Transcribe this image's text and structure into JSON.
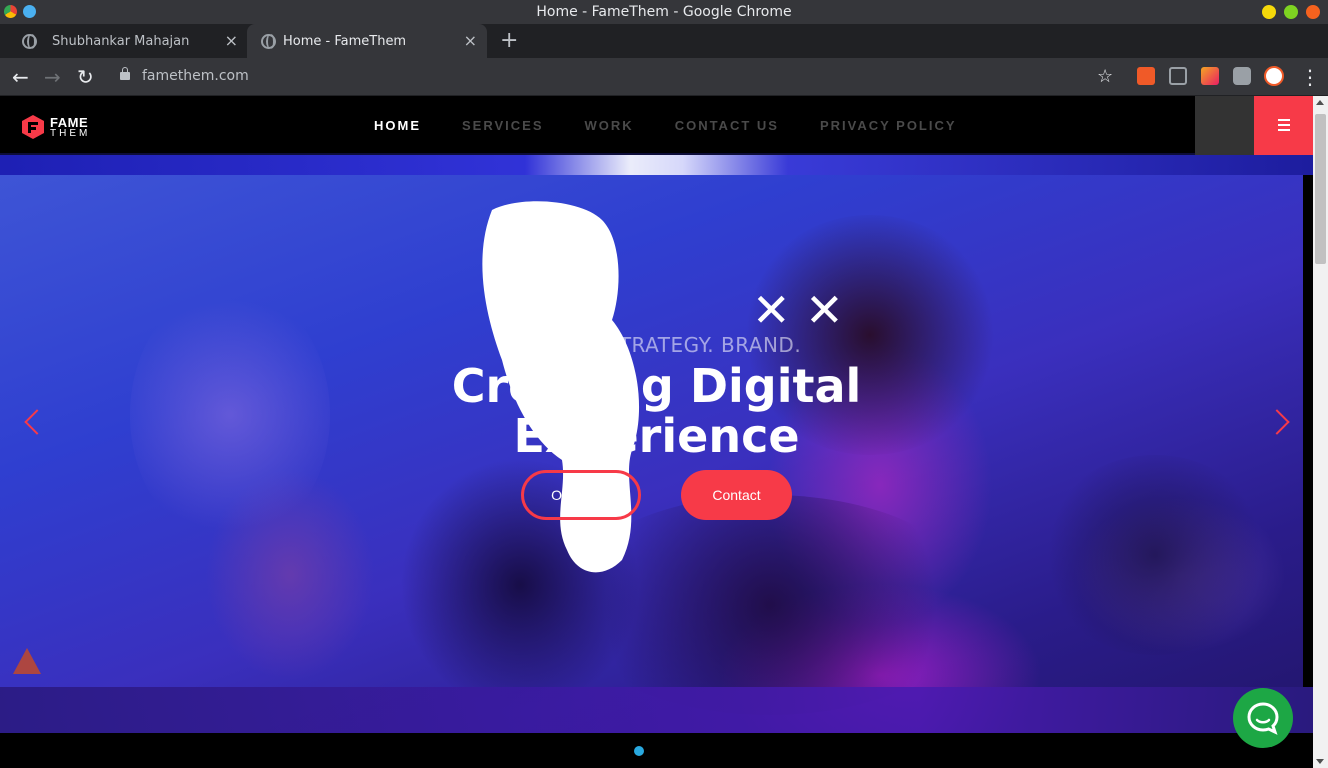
{
  "window": {
    "title": "Home - FameThem - Google Chrome"
  },
  "tabs": [
    {
      "label": "Shubhankar Mahajan",
      "close": "×"
    },
    {
      "label": "Home - FameThem",
      "close": "×"
    }
  ],
  "newtab": "+",
  "toolbar": {
    "back": "←",
    "forward": "→",
    "reload": "↻",
    "url": "famethem.com",
    "star": "☆",
    "menu": "⋮"
  },
  "site": {
    "logo": {
      "word1": "FAME",
      "word2": "THEM"
    },
    "nav": [
      {
        "label": "HOME"
      },
      {
        "label": "SERVICES"
      },
      {
        "label": "WORK"
      },
      {
        "label": "CONTACT US"
      },
      {
        "label": "PRIVACY POLICY"
      }
    ],
    "hero": {
      "tagline": "DESIGN. STRATEGY. BRAND.",
      "headline_line1": "Creating Digital",
      "headline_line2": "Experience",
      "button_work": "Our Work",
      "button_contact": "Contact"
    }
  },
  "colors": {
    "accent": "#f73a48",
    "chat": "#1da745",
    "dot": "#29a9e0"
  }
}
